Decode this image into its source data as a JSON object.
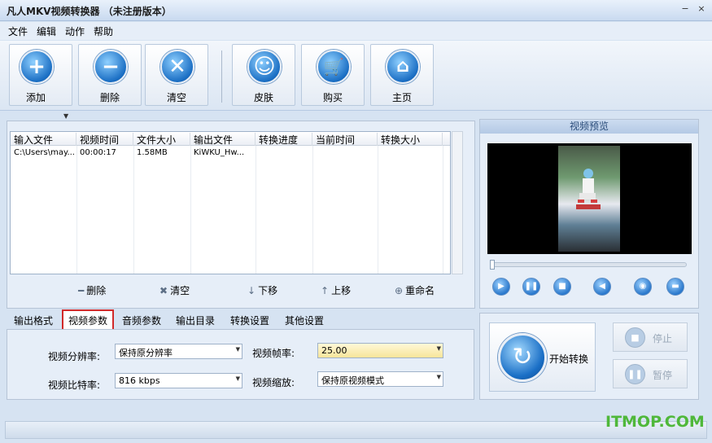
{
  "window": {
    "title": "凡人MKV视频转换器 （未注册版本）",
    "min": "−",
    "close": "×"
  },
  "menu": [
    "文件",
    "编辑",
    "动作",
    "帮助"
  ],
  "toolbar": {
    "add": "添加",
    "delete": "删除",
    "clear": "清空",
    "skin": "皮肤",
    "buy": "购买",
    "home": "主页"
  },
  "file_list": {
    "columns": [
      "输入文件",
      "视频时间",
      "文件大小",
      "输出文件",
      "转换进度",
      "当前时间",
      "转换大小"
    ],
    "rows": [
      {
        "input": "C:\\Users\\may...",
        "duration": "00:00:17",
        "size": "1.58MB",
        "output": "KiWKU_Hw...",
        "progress": "",
        "current": "",
        "conv_size": ""
      }
    ]
  },
  "list_actions": {
    "delete": "删除",
    "clear": "清空",
    "down": "下移",
    "up": "上移",
    "rename": "重命名"
  },
  "preview": {
    "title": "视频预览"
  },
  "tabs": [
    "输出格式",
    "视频参数",
    "音频参数",
    "输出目录",
    "转换设置",
    "其他设置"
  ],
  "active_tab": "视频参数",
  "video_params": {
    "resolution_label": "视频分辨率:",
    "resolution": "保持原分辨率",
    "framerate_label": "视频帧率:",
    "framerate": "25.00",
    "bitrate_label": "视频比特率:",
    "bitrate": "816 kbps",
    "scale_label": "视频缩放:",
    "scale": "保持原视频模式"
  },
  "convert": {
    "start": "开始转换",
    "stop": "停止",
    "pause": "暂停"
  },
  "watermark": "ITMOP.COM",
  "colors": {
    "accent": "#1b6fc4",
    "active_tab_border": "#d12a2a",
    "watermark": "#4fb83a"
  }
}
